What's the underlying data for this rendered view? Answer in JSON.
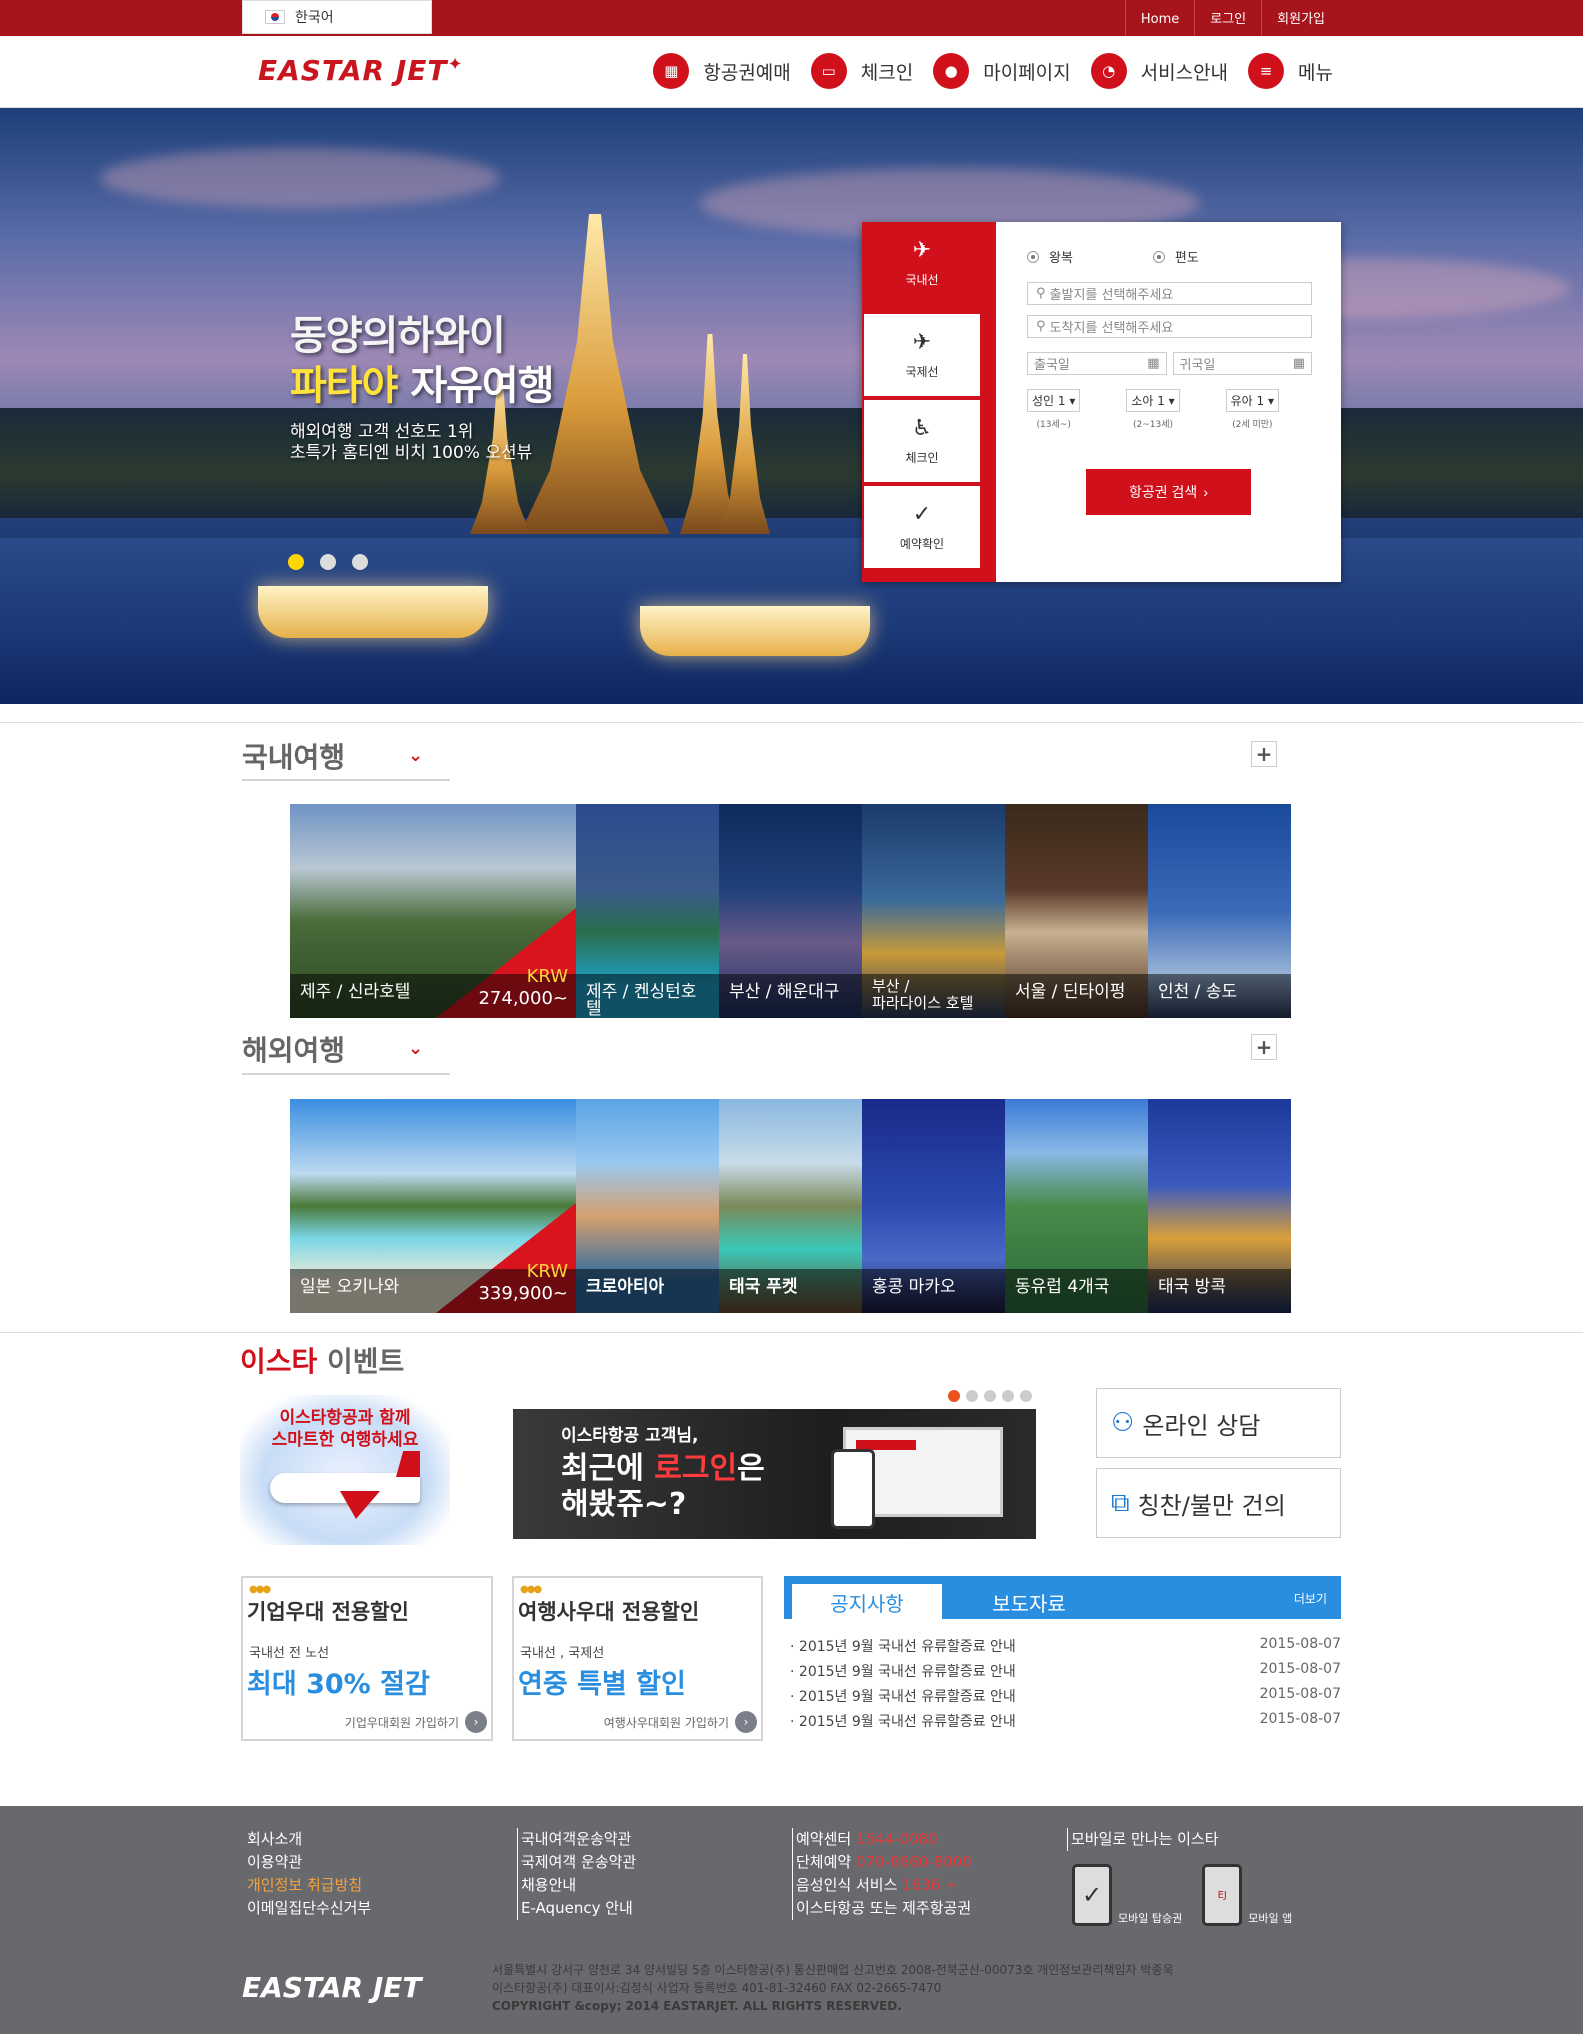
{
  "topbar": {
    "language": "한국어",
    "links": [
      "Home",
      "로그인",
      "회원가입"
    ]
  },
  "header": {
    "logo": "EASTAR JET",
    "nav": [
      {
        "label": "항공권예매",
        "icon": "calendar-icon"
      },
      {
        "label": "체크인",
        "icon": "ticket-icon"
      },
      {
        "label": "마이페이지",
        "icon": "person-icon"
      },
      {
        "label": "서비스안내",
        "icon": "chat-icon"
      },
      {
        "label": "메뉴",
        "icon": "menu-icon"
      }
    ]
  },
  "hero": {
    "title1": "동양의하와이",
    "title2_highlight": "파타야",
    "title2_rest": " 자유여행",
    "sub1": "해외여행 고객 선호도 1위",
    "sub2": "초특가 홈티엔 비치 100% 오션뷰"
  },
  "booking": {
    "tabs": [
      "국내선",
      "국제선",
      "체크인",
      "예약확인"
    ],
    "trip_types": [
      "왕복",
      "편도"
    ],
    "from_placeholder": "출발지를 선택해주세요",
    "to_placeholder": "도착지를 선택해주세요",
    "depart_placeholder": "출국일",
    "return_placeholder": "귀국일",
    "pax": [
      {
        "value": "성인 1",
        "note": "(13세~)"
      },
      {
        "value": "소아 1",
        "note": "(2~13세)"
      },
      {
        "value": "유아 1",
        "note": "(2세 미만)"
      }
    ],
    "search_label": "항공권 검색"
  },
  "domestic": {
    "title": "국내여행",
    "tiles": [
      {
        "caption": "제주 / 신라호텔",
        "currency": "KRW",
        "price": "274,000~"
      },
      {
        "caption": "제주 / 켄싱턴호텔"
      },
      {
        "caption": "부산 / 해운대구"
      },
      {
        "caption1": "부산 /",
        "caption2": "파라다이스 호텔"
      },
      {
        "caption": "서울 / 딘타이펑"
      },
      {
        "caption": "인천 / 송도"
      }
    ]
  },
  "overseas": {
    "title": "해외여행",
    "tiles": [
      {
        "caption": "일본 오키나와",
        "currency": "KRW",
        "price": "339,900~"
      },
      {
        "caption": "크로아티아"
      },
      {
        "caption": "태국 푸켓"
      },
      {
        "caption": "홍콩 마카오"
      },
      {
        "caption": "동유럽 4개국"
      },
      {
        "caption": "태국 방콕"
      }
    ]
  },
  "event": {
    "title_red": "이스타",
    "title_rest": " 이벤트",
    "left_banner_1": "이스타항공과 함께",
    "left_banner_2": "스마트한 여행하세요",
    "banner_line1": "이스타항공 고객님,",
    "banner_line2a": "최근에 ",
    "banner_line2b": "로그인",
    "banner_line2c": "은",
    "banner_line3": "해봤쥬~?",
    "side_buttons": [
      "온라인 상담",
      "칭찬/불만 건의"
    ]
  },
  "promos": [
    {
      "title": "기업우대 전용할인",
      "sub": "국내선 전 노선",
      "big": "최대 30% 절감",
      "link": "기업우대회원 가입하기"
    },
    {
      "title": "여행사우대 전용할인",
      "sub": "국내선 , 국제선",
      "big": "연중 특별 할인",
      "link": "여행사우대회원 가입하기"
    }
  ],
  "notice": {
    "tabs": [
      "공지사항",
      "보도자료"
    ],
    "more": "더보기",
    "items": [
      {
        "title": "2015년 9월 국내선 유류할증료 안내",
        "date": "2015-08-07"
      },
      {
        "title": "2015년 9월 국내선 유류할증료 안내",
        "date": "2015-08-07"
      },
      {
        "title": "2015년 9월 국내선 유류할증료 안내",
        "date": "2015-08-07"
      },
      {
        "title": "2015년 9월 국내선 유류할증료 안내",
        "date": "2015-08-07"
      }
    ]
  },
  "footer": {
    "col1": [
      "회사소개",
      "이용약관",
      "개인정보 취급방침",
      "이메일집단수신거부"
    ],
    "col2": [
      "국내여객운송약관",
      "국제여객 운송약관",
      "채용안내",
      "E-Aquency 안내"
    ],
    "col3": [
      {
        "label": "예약센터 ",
        "value": "1544-0080"
      },
      {
        "label": "단체예약 ",
        "value": "070-8660-8000"
      },
      {
        "label": "음성인식 서비스 ",
        "value": "1636 +"
      },
      {
        "label": "이스타항공 또는 제주항공권",
        "value": ""
      }
    ],
    "mobile_title": "모바일로 만나는 이스타",
    "mobile_items": [
      "모바일 탑승권",
      "모바일 앱"
    ],
    "logo": "EASTAR JET",
    "address1": "서울특별시 강서구 양천로 34 양서빌딩 5층 이스타항공(주)  통신판매업 신고번호 2008-전북군산-00073호 개인정보관리책임자 박종욱",
    "address2": "이스타항공(주) 대표이사:김정식 사업자 등록번호 401-81-32460 FAX 02-2665-7470",
    "copyright": "COPYRIGHT &copy; 2014 EASTARJET. ALL RIGHTS RESERVED."
  },
  "colors": {
    "brand_red": "#d0111b",
    "top_bar": "#a8141c",
    "notice_blue": "#2a8ee0",
    "footer_gray": "#68696d"
  }
}
